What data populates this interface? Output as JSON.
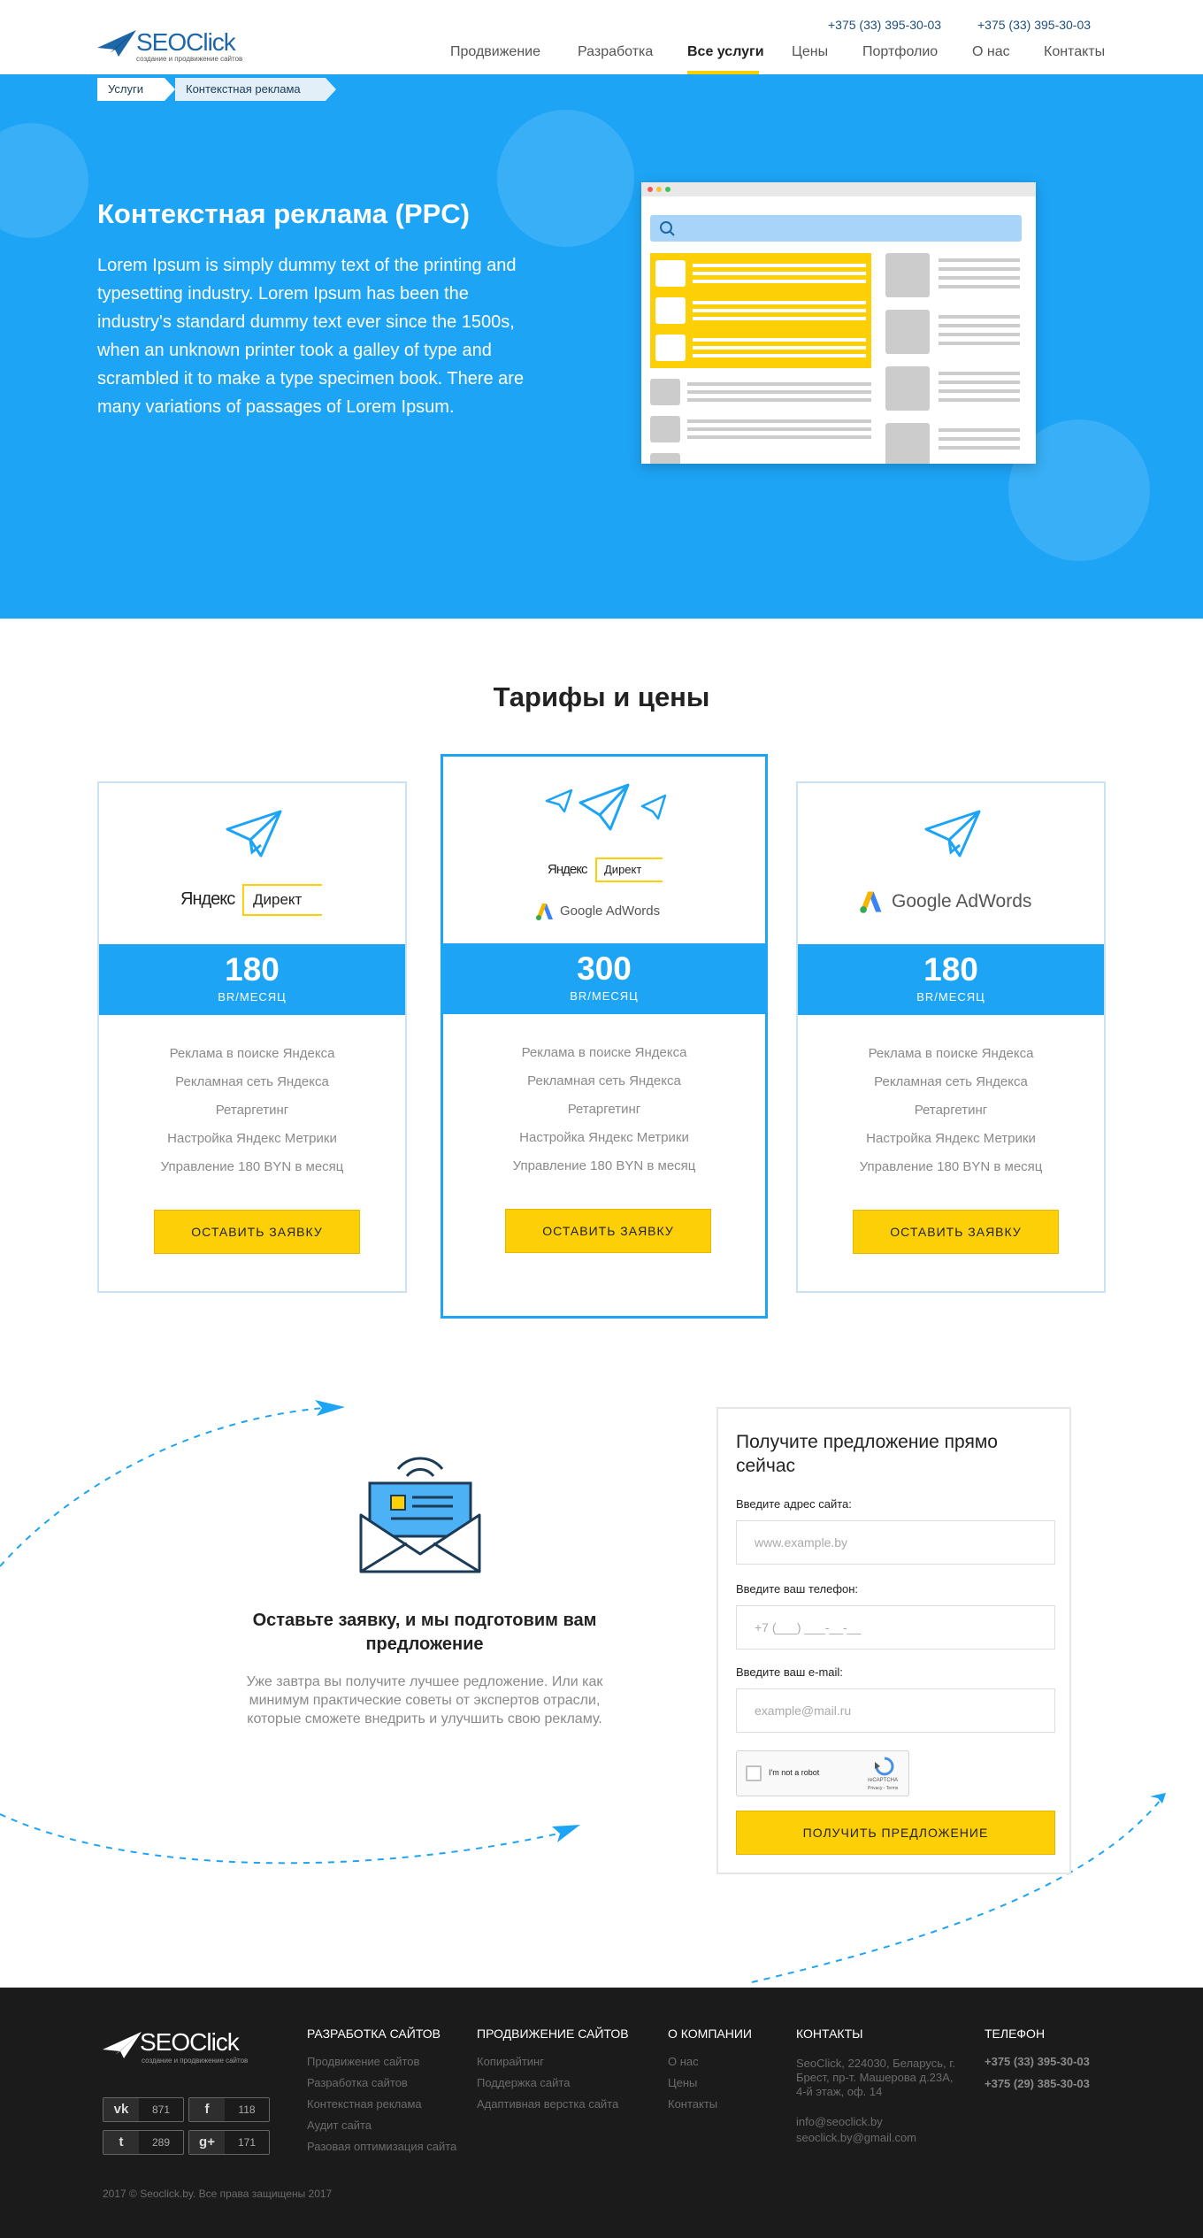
{
  "header": {
    "logo_text": "SEOClick",
    "logo_sub": "создание и продвижение сайтов",
    "phones": [
      "+375 (33) 395-30-03",
      "+375 (33) 395-30-03"
    ],
    "nav": [
      "Продвижение",
      "Разработка",
      "Все услуги",
      "Цены",
      "Портфолио",
      "О нас",
      "Контакты"
    ],
    "active_nav": "Все услуги"
  },
  "breadcrumbs": [
    "Услуги",
    "Контекстная реклама"
  ],
  "hero": {
    "title": "Контекстная реклама (PPC)",
    "text": "Lorem Ipsum is simply dummy text of the printing and typesetting industry. Lorem Ipsum has been the industry's standard dummy text ever since the 1500s, when an unknown printer took a galley of type and scrambled it to make a type specimen book. There are many variations of passages of Lorem Ipsum."
  },
  "tariffs": {
    "title": "Тарифы и цены",
    "brand_yandex": "Яндекс",
    "brand_direct": "Директ",
    "brand_google": "Google AdWords",
    "cards": [
      {
        "price": "180",
        "period": "BR/МЕСЯЦ",
        "features": [
          "Реклама в поиске Яндекса",
          "Рекламная сеть Яндекса",
          "Ретаргетинг",
          "Настройка Яндекс Метрики",
          "Управление 180 BYN в месяц"
        ],
        "button": "ОСТАВИТЬ ЗАЯВКУ"
      },
      {
        "price": "300",
        "period": "BR/МЕСЯЦ",
        "features": [
          "Реклама в поиске Яндекса",
          "Рекламная сеть Яндекса",
          "Ретаргетинг",
          "Настройка Яндекс Метрики",
          "Управление 180 BYN в месяц"
        ],
        "button": "ОСТАВИТЬ ЗАЯВКУ"
      },
      {
        "price": "180",
        "period": "BR/МЕСЯЦ",
        "features": [
          "Реклама в поиске Яндекса",
          "Рекламная сеть Яндекса",
          "Ретаргетинг",
          "Настройка Яндекс Метрики",
          "Управление 180 BYN в месяц"
        ],
        "button": "ОСТАВИТЬ ЗАЯВКУ"
      }
    ]
  },
  "cta": {
    "title": "Оставьте заявку, и мы подготовим вам предложение",
    "text": "Уже завтра вы получите лучшее редложение. Или как минимум практические советы от экспертов отрасли, которые сможете внедрить и улучшить свою рекламу."
  },
  "form": {
    "title": "Получите предложение прямо сейчас",
    "site_label": "Введите адрес сайта:",
    "site_placeholder": "www.example.by",
    "phone_label": "Введите ваш телефон:",
    "phone_placeholder": "+7 (___) ___-__-__",
    "email_label": "Введите ваш e-mail:",
    "email_placeholder": "example@mail.ru",
    "captcha_label": "I'm not a robot",
    "captcha_brand": "reCAPTCHA",
    "captcha_links": "Privacy - Terms",
    "submit": "ПОЛУЧИТЬ ПРЕДЛОЖЕНИЕ"
  },
  "footer": {
    "logo_text": "SEOClick",
    "logo_sub": "создание и продвижение сайтов",
    "columns": [
      {
        "title": "РАЗРАБОТКА САЙТОВ",
        "items": [
          "Продвижение сайтов",
          "Разработка сайтов",
          "Контекстная реклама",
          "Аудит сайта",
          "Разовая оптимизация сайта"
        ]
      },
      {
        "title": "ПРОДВИЖЕНИЕ САЙТОВ",
        "items": [
          "Копирайтинг",
          "Поддержка сайта",
          "Адаптивная верстка сайта"
        ]
      },
      {
        "title": "О КОМПАНИИ",
        "items": [
          "О нас",
          "Цены",
          "Контакты"
        ]
      }
    ],
    "contacts_title": "КОНТАКТЫ",
    "address": "SeoClick, 224030, Беларусь, г. Брест, пр-т. Машерова д.23А, 4-й этаж, оф. 14",
    "emails": [
      "info@seoclick.by",
      "seoclick.by@gmail.com"
    ],
    "phone_title": "ТЕЛЕФОН",
    "phones": [
      "+375 (33) 395-30-03",
      "+375 (29) 385-30-03"
    ],
    "social": [
      {
        "icon": "vk-icon",
        "glyph": "vk",
        "count": "871"
      },
      {
        "icon": "facebook-icon",
        "glyph": "f",
        "count": "118"
      },
      {
        "icon": "twitter-icon",
        "glyph": "t",
        "count": "289"
      },
      {
        "icon": "googleplus-icon",
        "glyph": "g+",
        "count": "171"
      }
    ],
    "copyright": "2017 © Seoclick.by. Все права защищены 2017"
  }
}
